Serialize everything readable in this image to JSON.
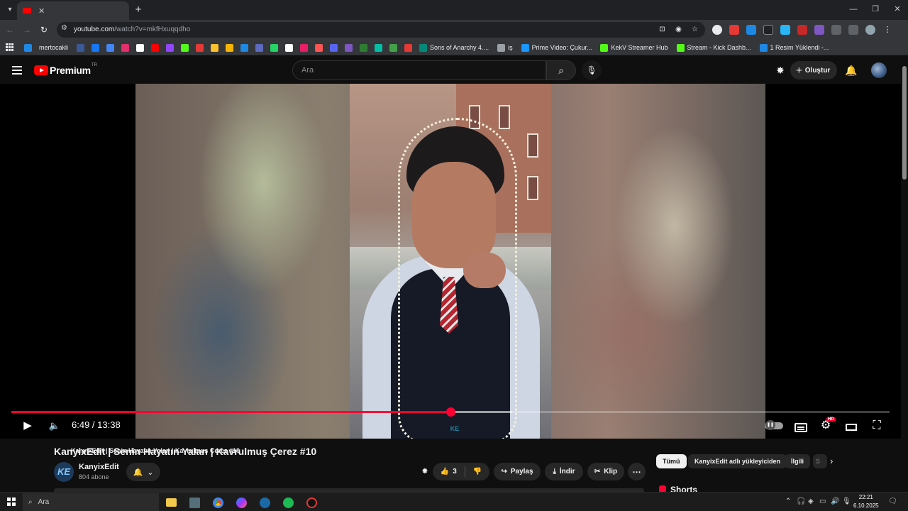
{
  "browser": {
    "tab_title": "KanyixEdit | Senin Hayatın Yalan | Kavrulmuş Çerez #10",
    "url_host": "youtube.com",
    "url_path": "/watch?v=mkfHxuqqdho",
    "new_tab_icon": "plus-icon",
    "window_controls": [
      "minimize-icon",
      "restore-icon",
      "close-icon"
    ]
  },
  "bookmarks": {
    "items": [
      {
        "label": "mertocakli",
        "color": "#ea4335"
      },
      {
        "label": "Sons of Anarchy 4....",
        "color": "#00897b"
      },
      {
        "label": "iş",
        "color": "#9aa0a6"
      },
      {
        "label": "Prime Video: Çukur...",
        "color": "#1a98ff"
      },
      {
        "label": "KekV Streamer Hub",
        "color": "#53fc18"
      },
      {
        "label": "Stream - Kick Dashb...",
        "color": "#53fc18"
      },
      {
        "label": "1 Resim Yüklendi -...",
        "color": "#1e88e5"
      }
    ],
    "icon_colors": [
      "#1e88e5",
      "#3b5998",
      "#1877f2",
      "#4285f4",
      "#e1306c",
      "#ffffff",
      "#ff0000",
      "#9146ff",
      "#53fc18",
      "#e53935",
      "#fbc02d",
      "#f4b400",
      "#1e88e5",
      "#5c6bc0",
      "#25d366",
      "#ffffff",
      "#e91e63",
      "#ff5252",
      "#5865f2",
      "#7e57c2",
      "#2e7d32",
      "#00bfa5",
      "#43a047",
      "#e53935"
    ]
  },
  "youtube": {
    "logo_text": "Premium",
    "region": "TR",
    "search_placeholder": "Ara",
    "create_label": "Oluştur"
  },
  "player": {
    "current_time": "6:49",
    "duration": "13:38",
    "time_display": "6:49 / 13:38",
    "progress_fraction": 0.4997,
    "buffer_fraction": 0.57,
    "quality_badge": "HD"
  },
  "video": {
    "title": "KanyixEdit | Senin Hayatın Yalan | Kavrulmuş Çerez #10",
    "channel": "KanyixEdit",
    "channel_initials": "KE",
    "subscribers": "804 abone",
    "likes": "3",
    "share_label": "Paylaş",
    "download_label": "İndir",
    "clip_label": "Klip"
  },
  "chips": [
    {
      "label": "Tümü",
      "active": true
    },
    {
      "label": "KanyixEdit adlı yükleyiciden",
      "active": false
    },
    {
      "label": "İlgili",
      "active": false
    },
    {
      "label": "S",
      "active": false
    }
  ],
  "shorts_title": "Shorts",
  "taskbar": {
    "search_label": "Ara",
    "time": "22:21",
    "date": "6.10.2025"
  }
}
